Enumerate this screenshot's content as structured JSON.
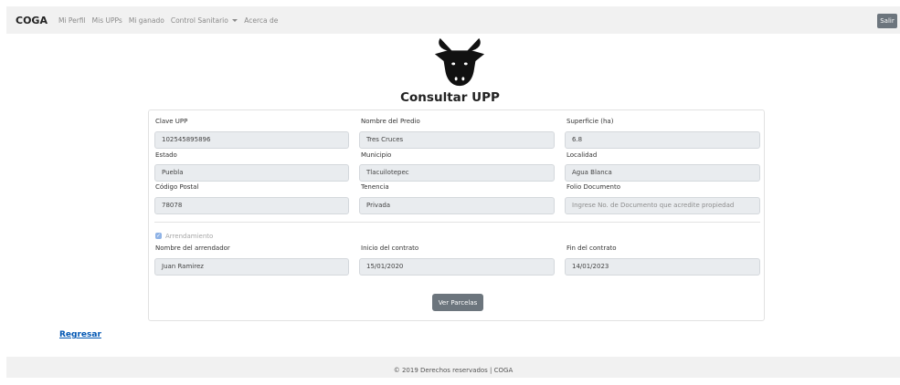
{
  "navbar": {
    "brand": "COGA",
    "links": [
      "Mi Perfil",
      "Mis UPPs",
      "Mi ganado",
      "Control Sanitario",
      "Acerca de"
    ],
    "logout_label": "Salir"
  },
  "page": {
    "title": "Consultar UPP"
  },
  "form": {
    "clave": {
      "label": "Clave UPP",
      "value": "102545895896"
    },
    "nombre_predio": {
      "label": "Nombre del Predio",
      "value": "Tres Cruces"
    },
    "superficie": {
      "label": "Superficie (ha)",
      "value": "6.8"
    },
    "estado": {
      "label": "Estado",
      "value": "Puebla"
    },
    "municipio": {
      "label": "Municipio",
      "value": "Tlacuilotepec"
    },
    "localidad": {
      "label": "Localidad",
      "value": "Agua Blanca"
    },
    "codigo_postal": {
      "label": "Código Postal",
      "value": "78078"
    },
    "tenencia": {
      "label": "Tenencia",
      "value": "Privada"
    },
    "folio": {
      "label": "Folio Documento",
      "placeholder": "Ingrese No. de Documento que acredite propiedad"
    },
    "arrendamiento": {
      "label": "Arrendamiento",
      "checked": true
    },
    "arrendador": {
      "label": "Nombre del arrendador",
      "value": "Juan Ramirez"
    },
    "inicio_contrato": {
      "label": "Inicio del contrato",
      "value": "15/01/2020"
    },
    "fin_contrato": {
      "label": "Fin del contrato",
      "value": "14/01/2023"
    }
  },
  "actions": {
    "ver_parcelas": "Ver Parcelas",
    "back": "Regresar"
  },
  "footer": {
    "text": "© 2019 Derechos reservados | COGA"
  },
  "icons": {
    "logo": "bull-head-icon",
    "checkbox": "checkmark-icon",
    "dropdown": "caret-down-icon"
  },
  "colors": {
    "navbar_bg": "#f1f1f1",
    "button_bg": "#6c757d",
    "field_bg": "#e9ecef",
    "link": "#0056b3"
  }
}
